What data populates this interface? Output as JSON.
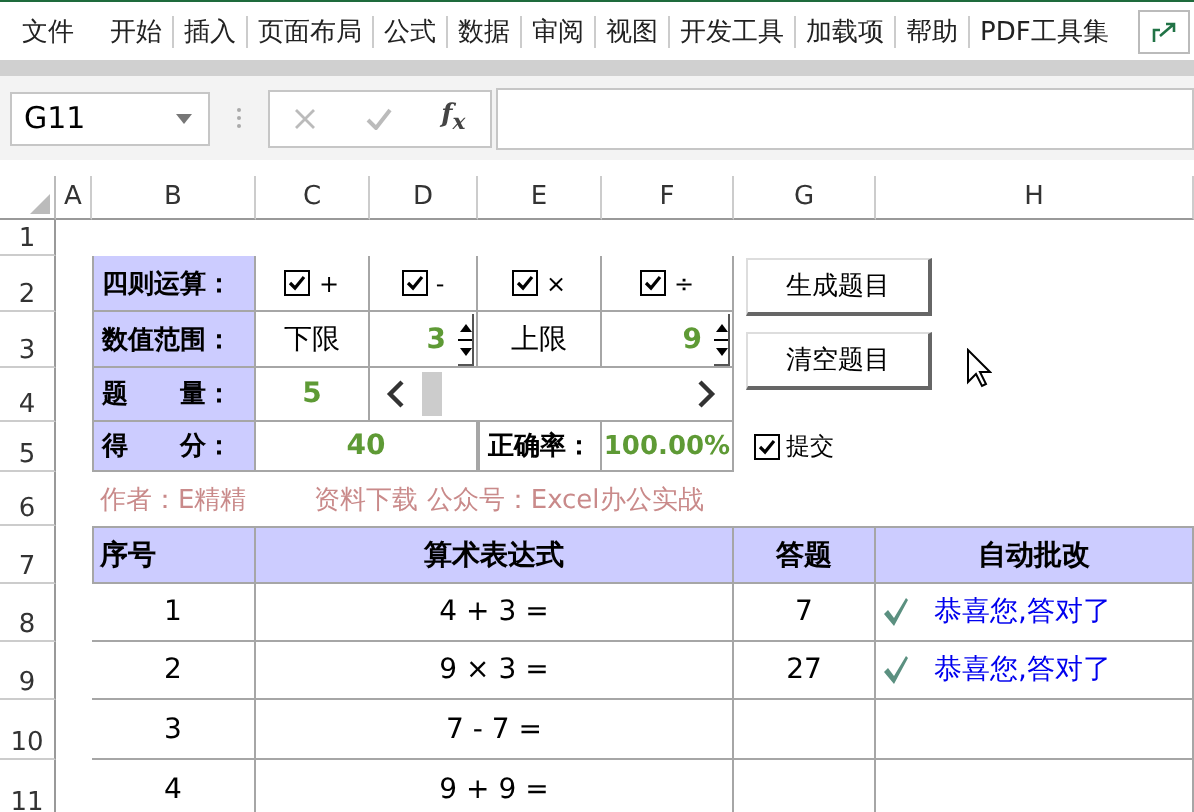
{
  "ribbon_tabs": [
    "文件",
    "开始",
    "插入",
    "页面布局",
    "公式",
    "数据",
    "审阅",
    "视图",
    "开发工具",
    "加载项",
    "帮助",
    "PDF工具集"
  ],
  "name_box": "G11",
  "function_label": "f$_{x}$",
  "columns": [
    "A",
    "B",
    "C",
    "D",
    "E",
    "F",
    "G",
    "H"
  ],
  "rows": [
    "1",
    "2",
    "3",
    "4",
    "5",
    "6",
    "7",
    "8",
    "9",
    "10",
    "11"
  ],
  "operations": {
    "label": "四则运算：",
    "items": [
      {
        "symbol": "+",
        "checked": true
      },
      {
        "symbol": "-",
        "checked": true
      },
      {
        "symbol": "×",
        "checked": true
      },
      {
        "symbol": "÷",
        "checked": true
      }
    ]
  },
  "range": {
    "label": "数值范围：",
    "lower_label": "下限",
    "lower": "3",
    "upper_label": "上限",
    "upper": "9"
  },
  "count": {
    "label": "题　　量：",
    "value": "5"
  },
  "score": {
    "label": "得　　分：",
    "value": "40",
    "accuracy_label": "正确率：",
    "accuracy": "100.00%"
  },
  "buttons": [
    "生成题目",
    "清空题目"
  ],
  "submit": {
    "label": "提交",
    "checked": true
  },
  "credits": [
    "作者：E精精",
    "资料下载 公众号：Excel办公实战"
  ],
  "table": {
    "columns": [
      "序号",
      "算术表达式",
      "答题",
      "自动批改"
    ],
    "rows": [
      {
        "no": "1",
        "expression": "4 + 3 =",
        "answer": "7",
        "graded": true,
        "result": "恭喜您,答对了"
      },
      {
        "no": "2",
        "expression": "9 × 3 =",
        "answer": "27",
        "graded": true,
        "result": "恭喜您,答对了"
      },
      {
        "no": "3",
        "expression": "7 - 7 =",
        "graded": false
      },
      {
        "no": "4",
        "expression": "9 + 9 =",
        "graded": false
      }
    ]
  }
}
